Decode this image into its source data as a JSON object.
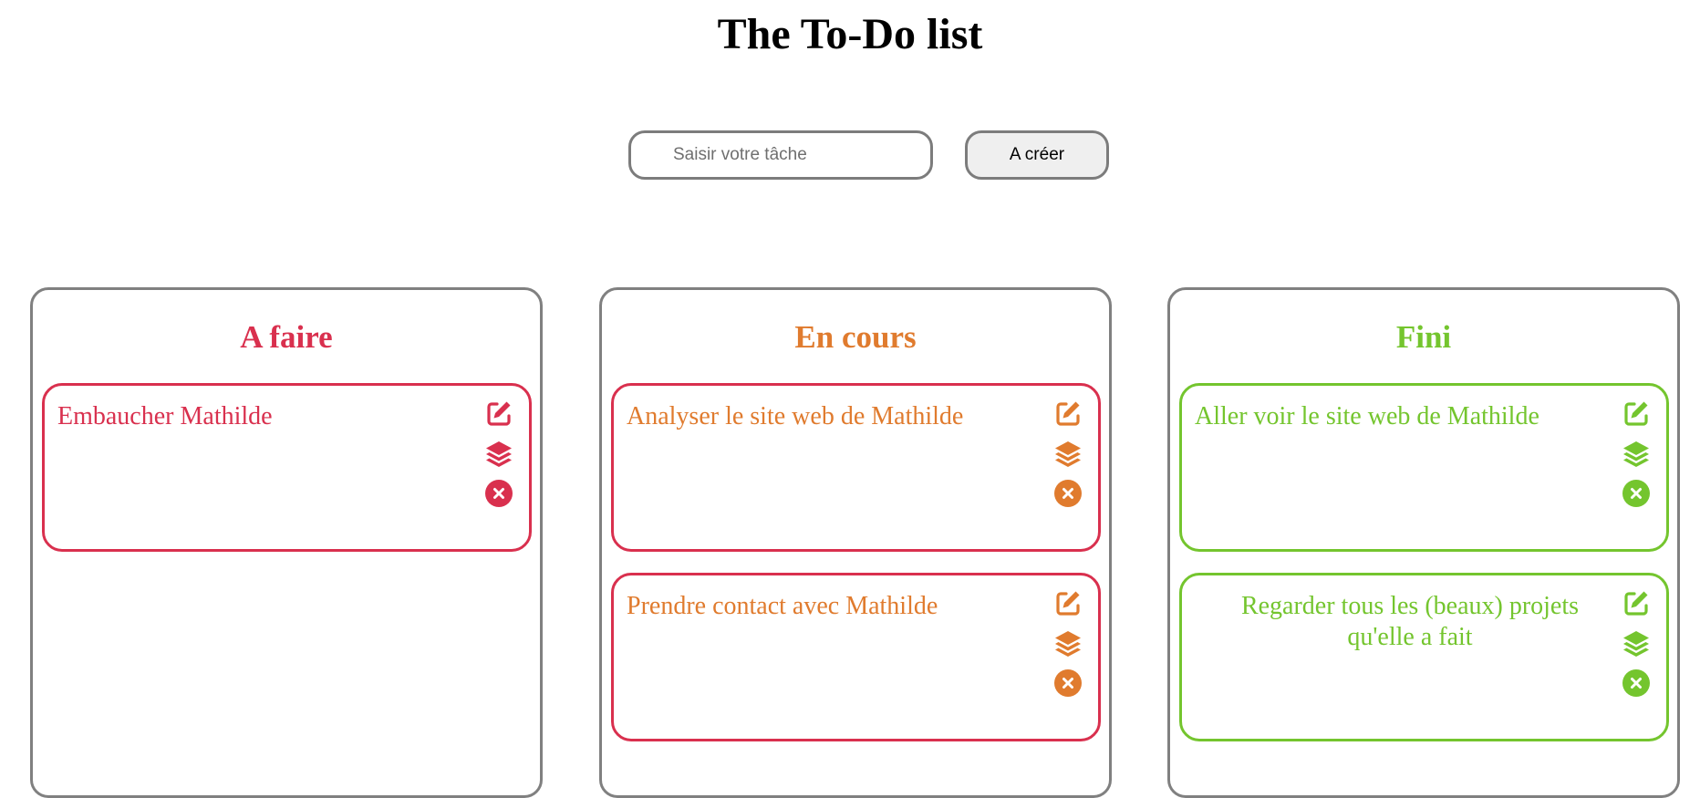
{
  "header": {
    "title": "The To-Do list"
  },
  "form": {
    "placeholder": "Saisir votre tâche",
    "value": "",
    "create_label": "A créer"
  },
  "colors": {
    "todo": "#d9304e",
    "doing": "#e07b2e",
    "done": "#74c52e",
    "border_gray": "#808080"
  },
  "columns": [
    {
      "title": "A faire",
      "color": "#d9304e",
      "cards": [
        {
          "text": "Embaucher Mathilde",
          "border": "#d9304e",
          "color": "#d9304e",
          "icons": [
            "edit-icon",
            "layers-icon",
            "close-circle-icon"
          ]
        }
      ]
    },
    {
      "title": "En cours",
      "color": "#e07b2e",
      "cards": [
        {
          "text": "Analyser le site web de Mathilde",
          "border": "#d9304e",
          "color": "#e07b2e",
          "icons": [
            "edit-icon",
            "layers-icon",
            "close-circle-icon"
          ]
        },
        {
          "text": "Prendre contact avec Mathilde",
          "border": "#d9304e",
          "color": "#e07b2e",
          "icons": [
            "edit-icon",
            "layers-icon",
            "close-circle-icon"
          ]
        }
      ]
    },
    {
      "title": "Fini",
      "color": "#74c52e",
      "cards": [
        {
          "text": "Aller voir le site web de Mathilde",
          "border": "#74c52e",
          "color": "#74c52e",
          "icons": [
            "edit-icon",
            "layers-icon",
            "close-circle-icon"
          ]
        },
        {
          "text": "Regarder tous les (beaux) projets qu'elle a fait",
          "border": "#74c52e",
          "color": "#74c52e",
          "icons": [
            "edit-icon",
            "layers-icon",
            "close-circle-icon"
          ]
        }
      ]
    }
  ]
}
